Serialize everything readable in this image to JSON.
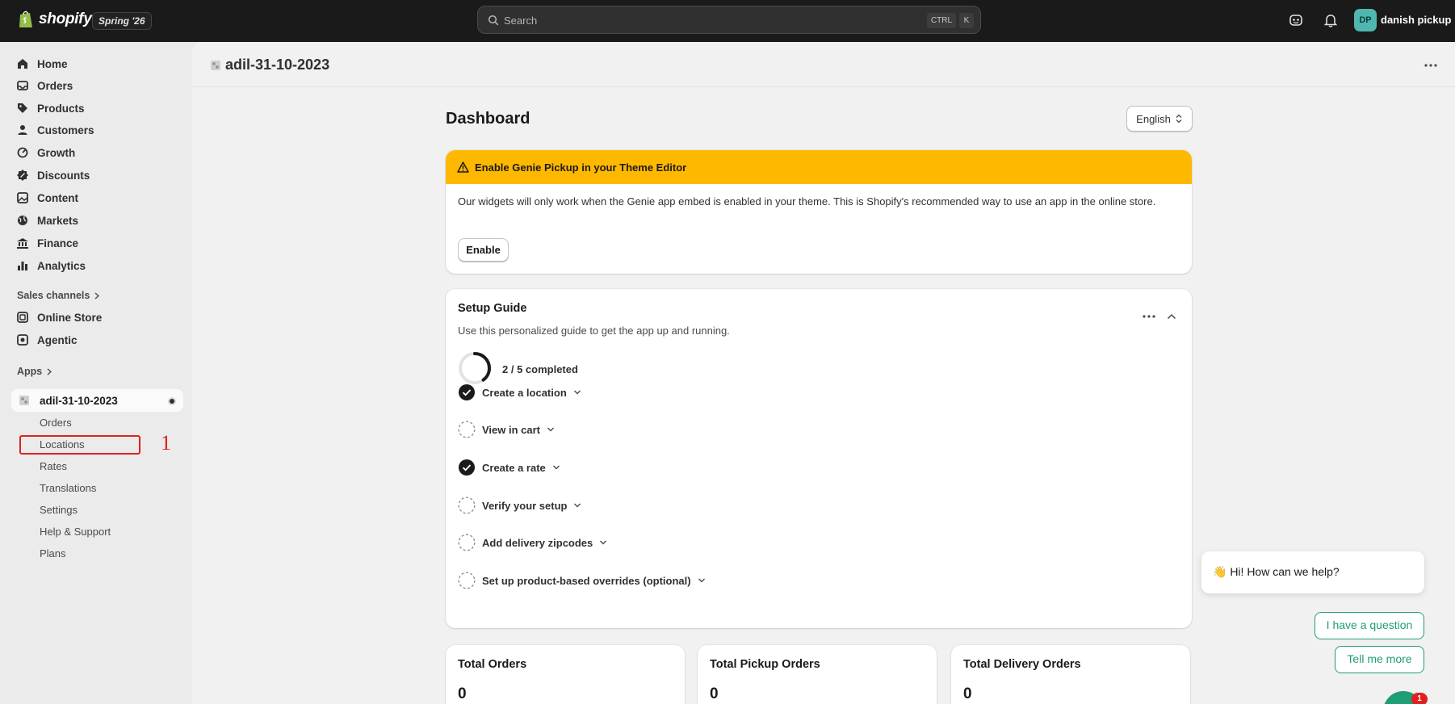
{
  "topbar": {
    "brand": "shopify",
    "edition": "Spring '26",
    "search_placeholder": "Search",
    "shortcut_ctrl": "CTRL",
    "shortcut_key": "K",
    "user_initials": "DP",
    "user_name": "danish pickup"
  },
  "sidebar": {
    "items": [
      {
        "label": "Home",
        "icon": "home-icon"
      },
      {
        "label": "Orders",
        "icon": "inbox-icon"
      },
      {
        "label": "Products",
        "icon": "tag-icon"
      },
      {
        "label": "Customers",
        "icon": "person-icon"
      },
      {
        "label": "Growth",
        "icon": "growth-icon"
      },
      {
        "label": "Discounts",
        "icon": "discount-icon"
      },
      {
        "label": "Content",
        "icon": "image-icon"
      },
      {
        "label": "Markets",
        "icon": "globe-icon"
      },
      {
        "label": "Finance",
        "icon": "bank-icon"
      },
      {
        "label": "Analytics",
        "icon": "chart-icon"
      }
    ],
    "sales_channels_label": "Sales channels",
    "sales_channels": [
      {
        "label": "Online Store",
        "icon": "store-icon"
      },
      {
        "label": "Agentic",
        "icon": "agentic-icon"
      }
    ],
    "apps_label": "Apps",
    "app_name": "adil-31-10-2023",
    "app_subitems": [
      "Orders",
      "Locations",
      "Rates",
      "Translations",
      "Settings",
      "Help & Support",
      "Plans"
    ],
    "annotation_number": "1"
  },
  "page": {
    "app_title": "adil-31-10-2023",
    "dashboard_title": "Dashboard",
    "language": "English"
  },
  "banner": {
    "title": "Enable Genie Pickup in your Theme Editor",
    "body": "Our widgets will only work when the Genie app embed is enabled in your theme. This is Shopify's recommended way to use an app in the online store.",
    "button": "Enable",
    "color": "#ffb800"
  },
  "setup_guide": {
    "title": "Setup Guide",
    "subtitle": "Use this personalized guide to get the app up and running.",
    "progress_text": "2 / 5 completed",
    "completed": 2,
    "total": 5,
    "tasks": [
      {
        "label": "Create a location",
        "done": true
      },
      {
        "label": "View in cart",
        "done": false
      },
      {
        "label": "Create a rate",
        "done": true
      },
      {
        "label": "Verify your setup",
        "done": false
      },
      {
        "label": "Add delivery zipcodes",
        "done": false
      },
      {
        "label": "Set up product-based overrides (optional)",
        "done": false
      }
    ]
  },
  "stats": [
    {
      "title": "Total Orders",
      "value": "0"
    },
    {
      "title": "Total Pickup Orders",
      "value": "0"
    },
    {
      "title": "Total Delivery Orders",
      "value": "0"
    }
  ],
  "chat": {
    "greeting": "👋 Hi! How can we help?",
    "option_1": "I have a question",
    "option_2": "Tell me more",
    "badge": "1",
    "accent": "#1e9e74"
  }
}
